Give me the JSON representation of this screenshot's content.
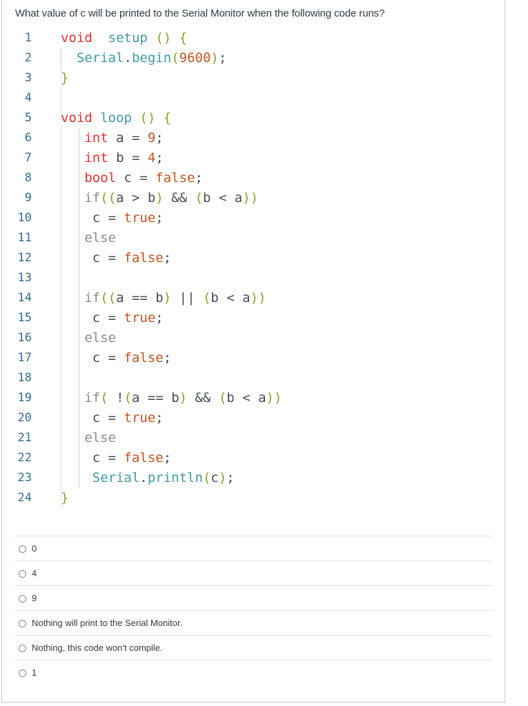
{
  "question": {
    "text": "What value of c will be printed to the Serial Monitor when the following code runs?"
  },
  "code": {
    "lines": [
      {
        "n": "1",
        "tokens": [
          [
            "kw",
            "void"
          ],
          [
            "",
            "  "
          ],
          [
            "fn",
            "setup"
          ],
          [
            "",
            " "
          ],
          [
            "par",
            "()"
          ],
          [
            "",
            " "
          ],
          [
            "par",
            "{"
          ]
        ]
      },
      {
        "n": "2",
        "tokens": [
          [
            "",
            "  "
          ],
          [
            "fn",
            "Serial"
          ],
          [
            "",
            "."
          ],
          [
            "fn",
            "begin"
          ],
          [
            "par",
            "("
          ],
          [
            "lit",
            "9600"
          ],
          [
            "par",
            ")"
          ],
          [
            "",
            ";"
          ]
        ]
      },
      {
        "n": "3",
        "tokens": [
          [
            "par",
            "}"
          ]
        ]
      },
      {
        "n": "4",
        "tokens": []
      },
      {
        "n": "5",
        "tokens": [
          [
            "kw",
            "void"
          ],
          [
            "",
            " "
          ],
          [
            "fn",
            "loop"
          ],
          [
            "",
            " "
          ],
          [
            "par",
            "()"
          ],
          [
            "",
            " "
          ],
          [
            "par",
            "{"
          ]
        ]
      },
      {
        "n": "6",
        "tokens": [
          [
            "",
            "   "
          ],
          [
            "kw",
            "int"
          ],
          [
            "",
            " a = "
          ],
          [
            "lit",
            "9"
          ],
          [
            "",
            ";"
          ]
        ]
      },
      {
        "n": "7",
        "tokens": [
          [
            "",
            "   "
          ],
          [
            "kw",
            "int"
          ],
          [
            "",
            " b = "
          ],
          [
            "lit",
            "4"
          ],
          [
            "",
            ";"
          ]
        ]
      },
      {
        "n": "8",
        "tokens": [
          [
            "",
            "   "
          ],
          [
            "kw",
            "bool"
          ],
          [
            "",
            " c = "
          ],
          [
            "lit",
            "false"
          ],
          [
            "",
            ";"
          ]
        ]
      },
      {
        "n": "9",
        "tokens": [
          [
            "",
            "   "
          ],
          [
            "els",
            "if"
          ],
          [
            "par",
            "(("
          ],
          [
            "",
            "a > b"
          ],
          [
            "par",
            ")"
          ],
          [
            "",
            " && "
          ],
          [
            "par",
            "("
          ],
          [
            "",
            "b < a"
          ],
          [
            "par",
            "))"
          ]
        ]
      },
      {
        "n": "10",
        "tokens": [
          [
            "",
            "    c = "
          ],
          [
            "lit",
            "true"
          ],
          [
            "",
            ";"
          ]
        ]
      },
      {
        "n": "11",
        "tokens": [
          [
            "",
            "   "
          ],
          [
            "els",
            "else"
          ]
        ]
      },
      {
        "n": "12",
        "tokens": [
          [
            "",
            "    c = "
          ],
          [
            "lit",
            "false"
          ],
          [
            "",
            ";"
          ]
        ]
      },
      {
        "n": "13",
        "tokens": []
      },
      {
        "n": "14",
        "tokens": [
          [
            "",
            "   "
          ],
          [
            "els",
            "if"
          ],
          [
            "par",
            "(("
          ],
          [
            "",
            "a == b"
          ],
          [
            "par",
            ")"
          ],
          [
            "",
            " || "
          ],
          [
            "par",
            "("
          ],
          [
            "",
            "b < a"
          ],
          [
            "par",
            "))"
          ]
        ]
      },
      {
        "n": "15",
        "tokens": [
          [
            "",
            "    c = "
          ],
          [
            "lit",
            "true"
          ],
          [
            "",
            ";"
          ]
        ]
      },
      {
        "n": "16",
        "tokens": [
          [
            "",
            "   "
          ],
          [
            "els",
            "else"
          ]
        ]
      },
      {
        "n": "17",
        "tokens": [
          [
            "",
            "    c = "
          ],
          [
            "lit",
            "false"
          ],
          [
            "",
            ";"
          ]
        ]
      },
      {
        "n": "18",
        "tokens": []
      },
      {
        "n": "19",
        "tokens": [
          [
            "",
            "   "
          ],
          [
            "els",
            "if"
          ],
          [
            "par",
            "("
          ],
          [
            "",
            " !"
          ],
          [
            "par",
            "("
          ],
          [
            "",
            "a == b"
          ],
          [
            "par",
            ")"
          ],
          [
            "",
            " && "
          ],
          [
            "par",
            "("
          ],
          [
            "",
            "b < a"
          ],
          [
            "par",
            "))"
          ]
        ]
      },
      {
        "n": "20",
        "tokens": [
          [
            "",
            "    c = "
          ],
          [
            "lit",
            "true"
          ],
          [
            "",
            ";"
          ]
        ]
      },
      {
        "n": "21",
        "tokens": [
          [
            "",
            "   "
          ],
          [
            "els",
            "else"
          ]
        ]
      },
      {
        "n": "22",
        "tokens": [
          [
            "",
            "    c = "
          ],
          [
            "lit",
            "false"
          ],
          [
            "",
            ";"
          ]
        ]
      },
      {
        "n": "23",
        "tokens": [
          [
            "",
            "    "
          ],
          [
            "fn",
            "Serial"
          ],
          [
            "",
            "."
          ],
          [
            "fn",
            "println"
          ],
          [
            "par",
            "("
          ],
          [
            "",
            "c"
          ],
          [
            "par",
            ")"
          ],
          [
            "",
            ";"
          ]
        ]
      },
      {
        "n": "24",
        "tokens": [
          [
            "par",
            "}"
          ]
        ]
      }
    ]
  },
  "answers": [
    {
      "label": "0"
    },
    {
      "label": "4"
    },
    {
      "label": "9"
    },
    {
      "label": "Nothing will print to the Serial Monitor."
    },
    {
      "label": "Nothing, this code won't compile."
    },
    {
      "label": "1"
    }
  ],
  "colors": {
    "keyword": "#e8302d",
    "function": "#3e9aa3",
    "literal": "#c5531f",
    "paren": "#8c9c28",
    "text": "#434f54",
    "line_number": "#2f6f8f"
  }
}
